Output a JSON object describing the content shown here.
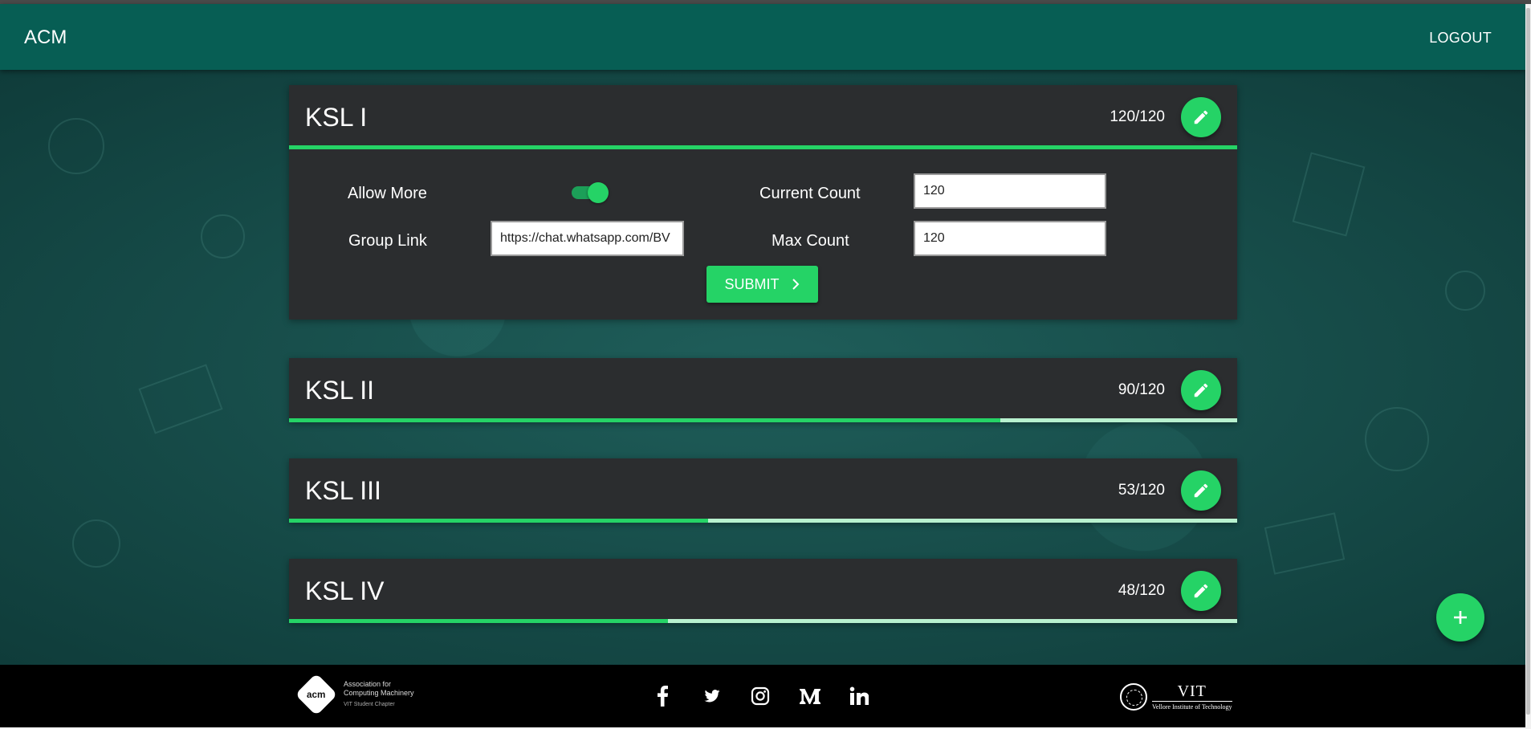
{
  "navbar": {
    "brand": "ACM",
    "logout_label": "LOGOUT"
  },
  "groups": [
    {
      "title": "KSL I",
      "count_text": "120/120",
      "fill": 1.0
    },
    {
      "title": "KSL II",
      "count_text": "90/120",
      "fill": 0.75
    },
    {
      "title": "KSL III",
      "count_text": "53/120",
      "fill": 0.4417
    },
    {
      "title": "KSL IV",
      "count_text": "48/120",
      "fill": 0.4
    }
  ],
  "edit_form": {
    "allow_more_label": "Allow More",
    "allow_more_on": true,
    "group_link_label": "Group Link",
    "group_link_value": "https://chat.whatsapp.com/BV",
    "current_count_label": "Current Count",
    "current_count_value": "120",
    "max_count_label": "Max Count",
    "max_count_value": "120",
    "submit_label": "SUBMIT"
  },
  "icons": {
    "edit": "pencil-icon",
    "add": "plus-icon",
    "submit": "chevron-right-icon",
    "social": [
      "facebook-icon",
      "twitter-icon",
      "instagram-icon",
      "medium-icon",
      "linkedin-icon"
    ]
  },
  "footer": {
    "acm_logo_mark": "acm",
    "acm_line1": "Association for",
    "acm_line2": "Computing Machinery",
    "acm_line3": "VIT Student Chapter",
    "vit_title": "VIT",
    "vit_subtitle": "Vellore Institute of Technology"
  },
  "colors": {
    "navbar": "#075e54",
    "accent": "#25d366",
    "card": "#2b2d2f",
    "progress_track": "#b8f1cf"
  }
}
